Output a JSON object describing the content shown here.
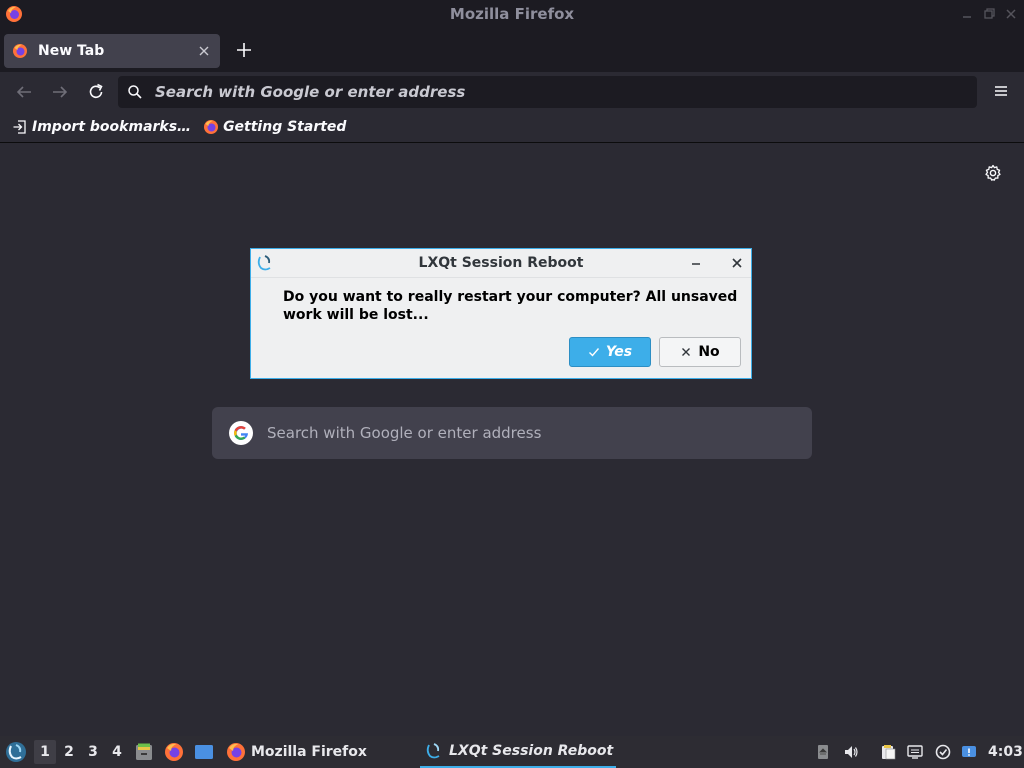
{
  "window": {
    "title": "Mozilla Firefox"
  },
  "tabs": [
    {
      "label": "New Tab",
      "active": true
    }
  ],
  "urlbar": {
    "placeholder": "Search with Google or enter address",
    "value": ""
  },
  "bookmarks": [
    {
      "label": "Import bookmarks…",
      "icon": "import-icon"
    },
    {
      "label": "Getting Started",
      "icon": "firefox-icon"
    }
  ],
  "content": {
    "search_placeholder": "Search with Google or enter address"
  },
  "dialog": {
    "title": "LXQt Session Reboot",
    "message": "Do you want to really restart your computer? All unsaved work will be lost...",
    "yes_label": "Yes",
    "no_label": "No"
  },
  "taskbar": {
    "workspaces": [
      "1",
      "2",
      "3",
      "4"
    ],
    "active_workspace": "1",
    "tasks": [
      {
        "label": "Mozilla Firefox",
        "icon": "firefox-icon"
      },
      {
        "label": "LXQt Session Reboot",
        "icon": "lxqt-icon",
        "active": true
      }
    ],
    "clock": "4:03"
  },
  "colors": {
    "accent": "#3daee9",
    "browser_bg": "#2b2a33",
    "chrome_bg": "#1c1b22",
    "dialog_bg": "#eff0f1"
  }
}
